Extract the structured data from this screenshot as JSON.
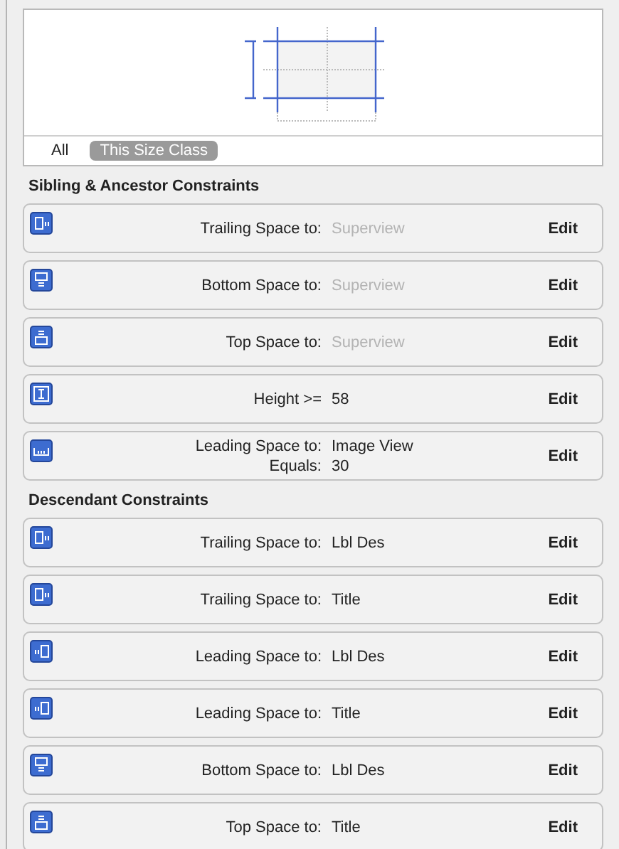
{
  "filters": [
    {
      "label": "All",
      "selected": false
    },
    {
      "label": "This Size Class",
      "selected": true
    }
  ],
  "sections": [
    {
      "title": "Sibling & Ancestor Constraints",
      "constraints": [
        {
          "kind": "trailing",
          "lines": [
            {
              "label": "Trailing Space to:",
              "value": "Superview",
              "dimmed": true
            }
          ],
          "action": "Edit"
        },
        {
          "kind": "bottom",
          "lines": [
            {
              "label": "Bottom Space to:",
              "value": "Superview",
              "dimmed": true
            }
          ],
          "action": "Edit"
        },
        {
          "kind": "top",
          "lines": [
            {
              "label": "Top Space to:",
              "value": "Superview",
              "dimmed": true
            }
          ],
          "action": "Edit"
        },
        {
          "kind": "height",
          "lines": [
            {
              "label": "Height >=",
              "value": "58",
              "dimmed": false
            }
          ],
          "action": "Edit"
        },
        {
          "kind": "leading",
          "lines": [
            {
              "label": "Leading Space to:",
              "value": "Image View",
              "dimmed": false
            },
            {
              "label": "Equals:",
              "value": "30",
              "dimmed": false
            }
          ],
          "action": "Edit"
        }
      ]
    },
    {
      "title": "Descendant Constraints",
      "constraints": [
        {
          "kind": "trailing",
          "lines": [
            {
              "label": "Trailing Space to:",
              "value": "Lbl Des",
              "dimmed": false
            }
          ],
          "action": "Edit"
        },
        {
          "kind": "trailing",
          "lines": [
            {
              "label": "Trailing Space to:",
              "value": "Title",
              "dimmed": false
            }
          ],
          "action": "Edit"
        },
        {
          "kind": "leading-inner",
          "lines": [
            {
              "label": "Leading Space to:",
              "value": "Lbl Des",
              "dimmed": false
            }
          ],
          "action": "Edit"
        },
        {
          "kind": "leading-inner",
          "lines": [
            {
              "label": "Leading Space to:",
              "value": "Title",
              "dimmed": false
            }
          ],
          "action": "Edit"
        },
        {
          "kind": "bottom",
          "lines": [
            {
              "label": "Bottom Space to:",
              "value": "Lbl Des",
              "dimmed": false
            }
          ],
          "action": "Edit"
        },
        {
          "kind": "top",
          "lines": [
            {
              "label": "Top Space to:",
              "value": "Title",
              "dimmed": false
            }
          ],
          "action": "Edit"
        }
      ]
    }
  ]
}
